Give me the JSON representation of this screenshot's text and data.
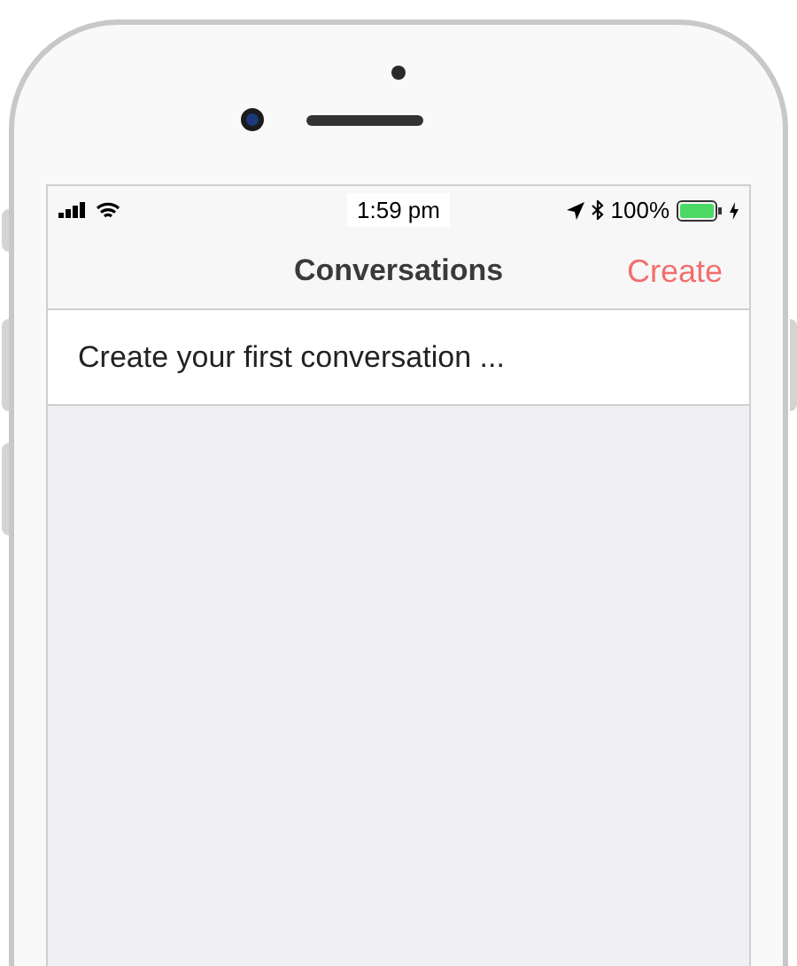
{
  "status_bar": {
    "time": "1:59 pm",
    "battery": "100%"
  },
  "nav_bar": {
    "title": "Conversations",
    "action": "Create"
  },
  "rows": [
    {
      "text": "Create your first conversation ..."
    }
  ]
}
